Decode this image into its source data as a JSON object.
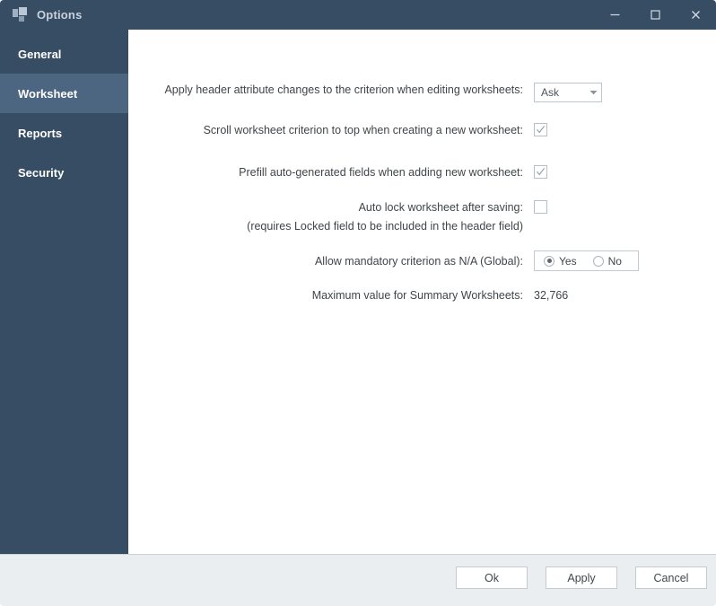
{
  "window": {
    "title": "Options",
    "icon": "app-squares-icon",
    "controls": {
      "minimize": "minimize-icon",
      "maximize": "maximize-icon",
      "close": "close-icon"
    }
  },
  "sidebar": {
    "items": [
      {
        "label": "General",
        "selected": false
      },
      {
        "label": "Worksheet",
        "selected": true
      },
      {
        "label": "Reports",
        "selected": false
      },
      {
        "label": "Security",
        "selected": false
      }
    ]
  },
  "settings": {
    "rows": [
      {
        "label": "Apply header attribute changes to the criterion when editing worksheets:",
        "control": "dropdown",
        "value": "Ask"
      },
      {
        "label": "Scroll worksheet criterion to top when creating a new worksheet:",
        "control": "checkbox",
        "checked": true
      },
      {
        "label": "Prefill auto-generated fields when adding new worksheet:",
        "control": "checkbox",
        "checked": true
      },
      {
        "label": "Auto lock worksheet after saving:",
        "sublabel": "(requires Locked field to be included in the header field)",
        "control": "checkbox",
        "checked": false
      },
      {
        "label": "Allow mandatory criterion as N/A (Global):",
        "control": "radio",
        "options": [
          "Yes",
          "No"
        ],
        "selected": "Yes"
      },
      {
        "label": "Maximum value for Summary Worksheets:",
        "control": "text",
        "value": "32,766"
      }
    ]
  },
  "footer": {
    "ok_label": "Ok",
    "apply_label": "Apply",
    "cancel_label": "Cancel"
  },
  "colors": {
    "titlebar": "#374d63",
    "sidebar": "#374d63",
    "sidebar_selected": "#4c6580",
    "footer": "#eaeef0",
    "text": "#3f4549"
  }
}
